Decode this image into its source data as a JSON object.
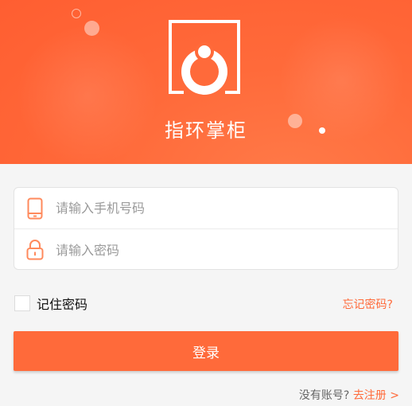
{
  "colors": {
    "accent": "#ff6a3a",
    "background": "#f5f5f5"
  },
  "header": {
    "app_name": "指环掌柜",
    "logo_icon": "ring-holder-logo-icon"
  },
  "form": {
    "phone_placeholder": "请输入手机号码",
    "phone_icon": "phone-icon",
    "password_placeholder": "请输入密码",
    "password_icon": "lock-icon"
  },
  "options": {
    "remember_label": "记住密码",
    "remember_checked": false,
    "forgot_label": "忘记密码?"
  },
  "actions": {
    "login_label": "登录"
  },
  "footer": {
    "no_account_text": "没有账号?",
    "register_link": "去注册 >"
  }
}
